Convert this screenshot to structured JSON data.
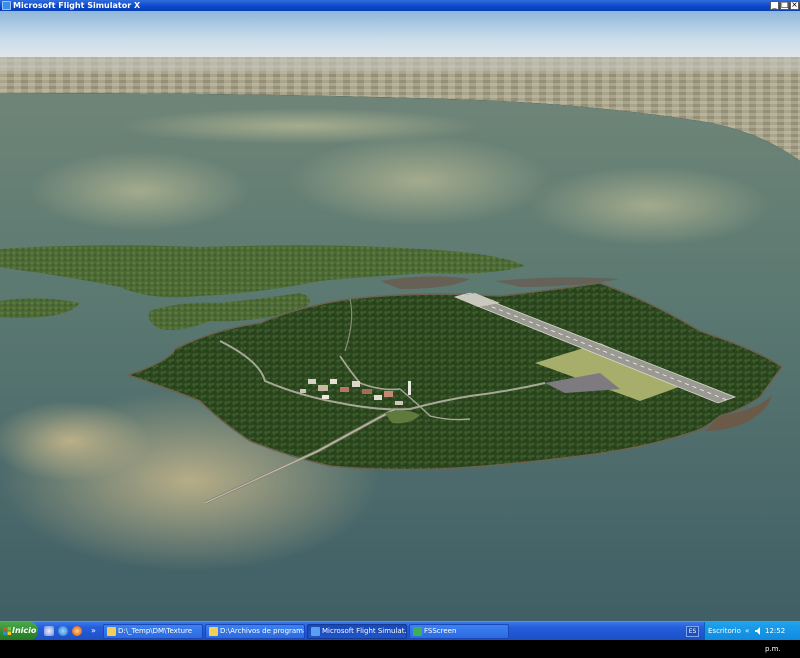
{
  "window": {
    "title": "Microsoft Flight Simulator X",
    "minimize_glyph": "_",
    "maximize_glyph": "□",
    "close_glyph": "×"
  },
  "taskbar": {
    "start_label": "Inicio",
    "quicklaunch_more": "»",
    "tasks": [
      {
        "label": "D:\\_Temp\\DM\\Texture",
        "icon": "folder-icon",
        "active": false
      },
      {
        "label": "D:\\Archivos de programa\\...",
        "icon": "folder-icon",
        "active": false
      },
      {
        "label": "Microsoft Flight Simulat...",
        "icon": "fsx-app-icon",
        "active": true
      },
      {
        "label": "FSScreen",
        "icon": "fsscreen-app-icon",
        "active": false
      }
    ],
    "language": "ES",
    "desktop_label": "Escritorio",
    "tray_chevron": "«",
    "clock": "12:52 p.m."
  },
  "colors": {
    "titlebar": "#0a46c8",
    "taskbar": "#245edb",
    "start": "#2f8a2f",
    "tray": "#0f8ae0",
    "water": "#4d6c6e",
    "forest": "#2f4a22"
  }
}
